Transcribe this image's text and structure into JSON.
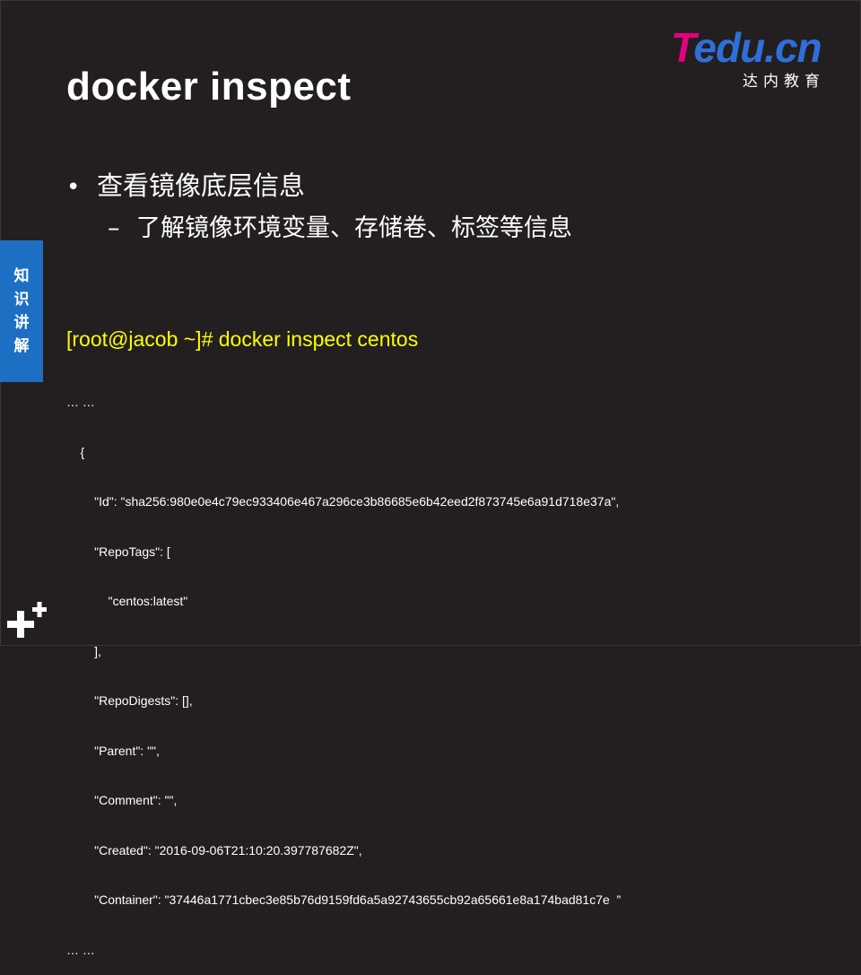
{
  "logo": {
    "t": "T",
    "rest": "edu.cn",
    "subtitle": "达内教育"
  },
  "title": "docker inspect",
  "bullets": {
    "level1": "查看镜像底层信息",
    "level1_marker": "•",
    "level2": "了解镜像环境变量、存储卷、标签等信息",
    "level2_marker": "–"
  },
  "side_tab": [
    "知",
    "识",
    "讲",
    "解"
  ],
  "command": "[root@jacob ~]# docker inspect centos",
  "code_lines": [
    "… …",
    "    {",
    "        \"Id\": \"sha256:980e0e4c79ec933406e467a296ce3b86685e6b42eed2f873745e6a91d718e37a\",",
    "        \"RepoTags\": [",
    "            \"centos:latest\"",
    "        ],",
    "        \"RepoDigests\": [],",
    "        \"Parent\": \"\",",
    "        \"Comment\": \"\",",
    "        \"Created\": \"2016-09-06T21:10:20.397787682Z\",",
    "        \"Container\": \"37446a1771cbec3e85b76d9159fd6a5a92743655cb92a65661e8a174bad81c7e  ”",
    "… …"
  ],
  "colors": {
    "background": "#231f20",
    "command": "#ffff00",
    "side_tab": "#1c6fc2",
    "logo_magenta": "#e4007f",
    "logo_blue": "#2e6fd9"
  },
  "icons": [
    "plus-icon"
  ]
}
